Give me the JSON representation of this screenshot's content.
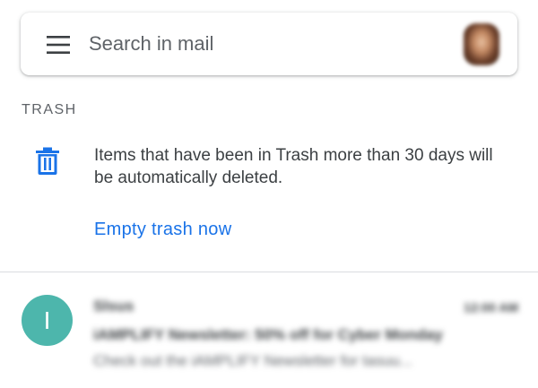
{
  "search": {
    "placeholder": "Search in mail"
  },
  "trash": {
    "header": "TRASH",
    "info": "Items that have been in Trash more than 30 days will be automatically deleted.",
    "empty_action": "Empty trash now"
  },
  "email": {
    "avatar_letter": "I",
    "avatar_color": "#4db6ac",
    "sender": "Slsus",
    "time": "12:00 AM",
    "subject": "iAMPLIFY Newsletter: 50% off for Cyber Monday",
    "snippet": "Check out the iAMPLIFY Newsletter for tasuu..."
  },
  "colors": {
    "accent": "#1a73e8",
    "text_primary": "#3c4043",
    "text_secondary": "#5f6368"
  },
  "icons": {
    "menu": "hamburger-menu-icon",
    "trash": "trash-icon"
  }
}
